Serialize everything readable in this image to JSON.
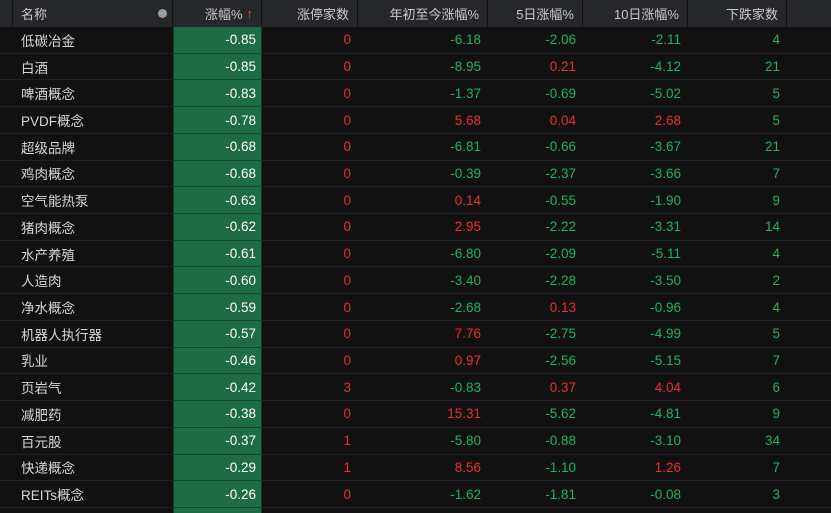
{
  "table": {
    "columns": {
      "name": "名称",
      "change": "涨幅%",
      "sort_arrow": "↑",
      "limit_up": "涨停家数",
      "ytd": "年初至今涨幅%",
      "d5": "5日涨幅%",
      "d10": "10日涨幅%",
      "decliners": "下跌家数"
    },
    "rows": [
      {
        "name": "低碳冶金",
        "change": "-0.85",
        "limit_up": "0",
        "ytd": "-6.18",
        "d5": "-2.06",
        "d10": "-2.11",
        "decliners": "4"
      },
      {
        "name": "白酒",
        "change": "-0.85",
        "limit_up": "0",
        "ytd": "-8.95",
        "d5": "0.21",
        "d10": "-4.12",
        "decliners": "21"
      },
      {
        "name": "啤酒概念",
        "change": "-0.83",
        "limit_up": "0",
        "ytd": "-1.37",
        "d5": "-0.69",
        "d10": "-5.02",
        "decliners": "5"
      },
      {
        "name": "PVDF概念",
        "change": "-0.78",
        "limit_up": "0",
        "ytd": "5.68",
        "d5": "0.04",
        "d10": "2.68",
        "decliners": "5"
      },
      {
        "name": "超级品牌",
        "change": "-0.68",
        "limit_up": "0",
        "ytd": "-6.81",
        "d5": "-0.66",
        "d10": "-3.67",
        "decliners": "21"
      },
      {
        "name": "鸡肉概念",
        "change": "-0.68",
        "limit_up": "0",
        "ytd": "-0.39",
        "d5": "-2.37",
        "d10": "-3.66",
        "decliners": "7"
      },
      {
        "name": "空气能热泵",
        "change": "-0.63",
        "limit_up": "0",
        "ytd": "0.14",
        "d5": "-0.55",
        "d10": "-1.90",
        "decliners": "9"
      },
      {
        "name": "猪肉概念",
        "change": "-0.62",
        "limit_up": "0",
        "ytd": "2.95",
        "d5": "-2.22",
        "d10": "-3.31",
        "decliners": "14"
      },
      {
        "name": "水产养殖",
        "change": "-0.61",
        "limit_up": "0",
        "ytd": "-6.80",
        "d5": "-2.09",
        "d10": "-5.11",
        "decliners": "4"
      },
      {
        "name": "人造肉",
        "change": "-0.60",
        "limit_up": "0",
        "ytd": "-3.40",
        "d5": "-2.28",
        "d10": "-3.50",
        "decliners": "2"
      },
      {
        "name": "净水概念",
        "change": "-0.59",
        "limit_up": "0",
        "ytd": "-2.68",
        "d5": "0.13",
        "d10": "-0.96",
        "decliners": "4"
      },
      {
        "name": "机器人执行器",
        "change": "-0.57",
        "limit_up": "0",
        "ytd": "7.76",
        "d5": "-2.75",
        "d10": "-4.99",
        "decliners": "5"
      },
      {
        "name": "乳业",
        "change": "-0.46",
        "limit_up": "0",
        "ytd": "0.97",
        "d5": "-2.56",
        "d10": "-5.15",
        "decliners": "7"
      },
      {
        "name": "页岩气",
        "change": "-0.42",
        "limit_up": "3",
        "ytd": "-0.83",
        "d5": "0.37",
        "d10": "4.04",
        "decliners": "6"
      },
      {
        "name": "减肥药",
        "change": "-0.38",
        "limit_up": "0",
        "ytd": "15.31",
        "d5": "-5.62",
        "d10": "-4.81",
        "decliners": "9"
      },
      {
        "name": "百元股",
        "change": "-0.37",
        "limit_up": "1",
        "ytd": "-5.80",
        "d5": "-0.88",
        "d10": "-3.10",
        "decliners": "34"
      },
      {
        "name": "快递概念",
        "change": "-0.29",
        "limit_up": "1",
        "ytd": "8.56",
        "d5": "-1.10",
        "d10": "1.26",
        "decliners": "7"
      },
      {
        "name": "REITs概念",
        "change": "-0.26",
        "limit_up": "0",
        "ytd": "-1.62",
        "d5": "-1.81",
        "d10": "-0.08",
        "decliners": "3"
      }
    ]
  },
  "colors": {
    "up_red": "#ee2d2d",
    "down_green": "#1db35f",
    "change_cell_bg": "#1e6c45",
    "sort_arrow": "#ff4e2a",
    "header_bg": "#26272b",
    "row_bg": "#111112"
  }
}
